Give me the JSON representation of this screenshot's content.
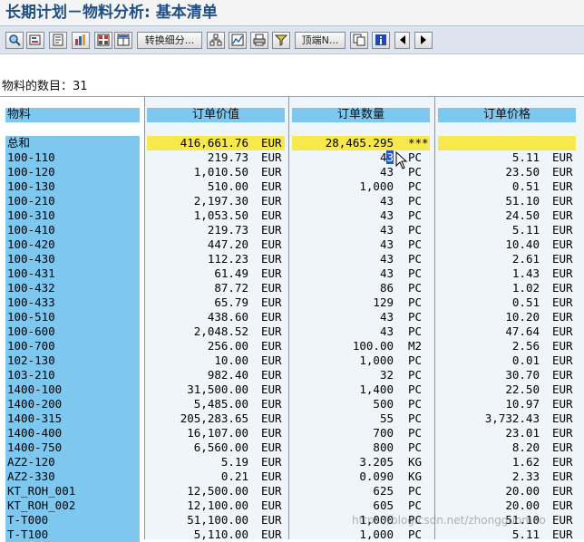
{
  "window": {
    "title": "长期计划－物料分析: 基本清单"
  },
  "toolbar": {
    "buttons": [
      {
        "icon": "magnifier-icon"
      },
      {
        "icon": "details-icon"
      },
      {
        "icon": "filter-icon"
      },
      {
        "icon": "sort-icon"
      },
      {
        "icon": "subtotal-icon"
      },
      {
        "icon": "layout-icon"
      },
      {
        "label": "转换细分..."
      },
      {
        "icon": "hierarchy-icon"
      },
      {
        "icon": "graphic-icon"
      },
      {
        "icon": "print-icon"
      },
      {
        "icon": "filter-funnel-icon"
      },
      {
        "label": "顶端N..."
      },
      {
        "icon": "copy-icon"
      },
      {
        "icon": "info-icon"
      },
      {
        "icon": "arrow-left-icon"
      },
      {
        "icon": "arrow-right-icon"
      }
    ]
  },
  "summary": {
    "label": "物料的数目：",
    "value": "31"
  },
  "table": {
    "headers": [
      "物料",
      "订单价值",
      "订单数量",
      "订单价格"
    ],
    "total": {
      "material": "总和",
      "value": "416,661.76",
      "value_unit": "EUR",
      "qty": "28,465.295",
      "qty_unit": "***",
      "price": "",
      "price_unit": ""
    },
    "rows": [
      {
        "material": "100-110",
        "value": "219.73",
        "value_unit": "EUR",
        "qty": "43",
        "qty_unit": "PC",
        "price": "5.11",
        "price_unit": "EUR"
      },
      {
        "material": "100-120",
        "value": "1,010.50",
        "value_unit": "EUR",
        "qty": "43",
        "qty_unit": "PC",
        "price": "23.50",
        "price_unit": "EUR"
      },
      {
        "material": "100-130",
        "value": "510.00",
        "value_unit": "EUR",
        "qty": "1,000",
        "qty_unit": "PC",
        "price": "0.51",
        "price_unit": "EUR"
      },
      {
        "material": "100-210",
        "value": "2,197.30",
        "value_unit": "EUR",
        "qty": "43",
        "qty_unit": "PC",
        "price": "51.10",
        "price_unit": "EUR"
      },
      {
        "material": "100-310",
        "value": "1,053.50",
        "value_unit": "EUR",
        "qty": "43",
        "qty_unit": "PC",
        "price": "24.50",
        "price_unit": "EUR"
      },
      {
        "material": "100-410",
        "value": "219.73",
        "value_unit": "EUR",
        "qty": "43",
        "qty_unit": "PC",
        "price": "5.11",
        "price_unit": "EUR"
      },
      {
        "material": "100-420",
        "value": "447.20",
        "value_unit": "EUR",
        "qty": "43",
        "qty_unit": "PC",
        "price": "10.40",
        "price_unit": "EUR"
      },
      {
        "material": "100-430",
        "value": "112.23",
        "value_unit": "EUR",
        "qty": "43",
        "qty_unit": "PC",
        "price": "2.61",
        "price_unit": "EUR"
      },
      {
        "material": "100-431",
        "value": "61.49",
        "value_unit": "EUR",
        "qty": "43",
        "qty_unit": "PC",
        "price": "1.43",
        "price_unit": "EUR"
      },
      {
        "material": "100-432",
        "value": "87.72",
        "value_unit": "EUR",
        "qty": "86",
        "qty_unit": "PC",
        "price": "1.02",
        "price_unit": "EUR"
      },
      {
        "material": "100-433",
        "value": "65.79",
        "value_unit": "EUR",
        "qty": "129",
        "qty_unit": "PC",
        "price": "0.51",
        "price_unit": "EUR"
      },
      {
        "material": "100-510",
        "value": "438.60",
        "value_unit": "EUR",
        "qty": "43",
        "qty_unit": "PC",
        "price": "10.20",
        "price_unit": "EUR"
      },
      {
        "material": "100-600",
        "value": "2,048.52",
        "value_unit": "EUR",
        "qty": "43",
        "qty_unit": "PC",
        "price": "47.64",
        "price_unit": "EUR"
      },
      {
        "material": "100-700",
        "value": "256.00",
        "value_unit": "EUR",
        "qty": "100.00",
        "qty_unit": "M2",
        "price": "2.56",
        "price_unit": "EUR"
      },
      {
        "material": "102-130",
        "value": "10.00",
        "value_unit": "EUR",
        "qty": "1,000",
        "qty_unit": "PC",
        "price": "0.01",
        "price_unit": "EUR"
      },
      {
        "material": "103-210",
        "value": "982.40",
        "value_unit": "EUR",
        "qty": "32",
        "qty_unit": "PC",
        "price": "30.70",
        "price_unit": "EUR"
      },
      {
        "material": "1400-100",
        "value": "31,500.00",
        "value_unit": "EUR",
        "qty": "1,400",
        "qty_unit": "PC",
        "price": "22.50",
        "price_unit": "EUR"
      },
      {
        "material": "1400-200",
        "value": "5,485.00",
        "value_unit": "EUR",
        "qty": "500",
        "qty_unit": "PC",
        "price": "10.97",
        "price_unit": "EUR"
      },
      {
        "material": "1400-315",
        "value": "205,283.65",
        "value_unit": "EUR",
        "qty": "55",
        "qty_unit": "PC",
        "price": "3,732.43",
        "price_unit": "EUR"
      },
      {
        "material": "1400-400",
        "value": "16,107.00",
        "value_unit": "EUR",
        "qty": "700",
        "qty_unit": "PC",
        "price": "23.01",
        "price_unit": "EUR"
      },
      {
        "material": "1400-750",
        "value": "6,560.00",
        "value_unit": "EUR",
        "qty": "800",
        "qty_unit": "PC",
        "price": "8.20",
        "price_unit": "EUR"
      },
      {
        "material": "AZ2-120",
        "value": "5.19",
        "value_unit": "EUR",
        "qty": "3.205",
        "qty_unit": "KG",
        "price": "1.62",
        "price_unit": "EUR"
      },
      {
        "material": "AZ2-330",
        "value": "0.21",
        "value_unit": "EUR",
        "qty": "0.090",
        "qty_unit": "KG",
        "price": "2.33",
        "price_unit": "EUR"
      },
      {
        "material": "KT_ROH_001",
        "value": "12,500.00",
        "value_unit": "EUR",
        "qty": "625",
        "qty_unit": "PC",
        "price": "20.00",
        "price_unit": "EUR"
      },
      {
        "material": "KT_ROH_002",
        "value": "12,100.00",
        "value_unit": "EUR",
        "qty": "605",
        "qty_unit": "PC",
        "price": "20.00",
        "price_unit": "EUR"
      },
      {
        "material": "T-T000",
        "value": "51,100.00",
        "value_unit": "EUR",
        "qty": "1,000",
        "qty_unit": "PC",
        "price": "51.10",
        "price_unit": "EUR"
      },
      {
        "material": "T-T100",
        "value": "5,110.00",
        "value_unit": "EUR",
        "qty": "1,000",
        "qty_unit": "PC",
        "price": "5.11",
        "price_unit": "EUR"
      }
    ]
  },
  "watermark": "https://blog.csdn.net/zhongguomao",
  "colors": {
    "header_blue": "#7ec8f0",
    "total_yellow": "#f7e84c",
    "title_blue": "#1f4f84"
  }
}
